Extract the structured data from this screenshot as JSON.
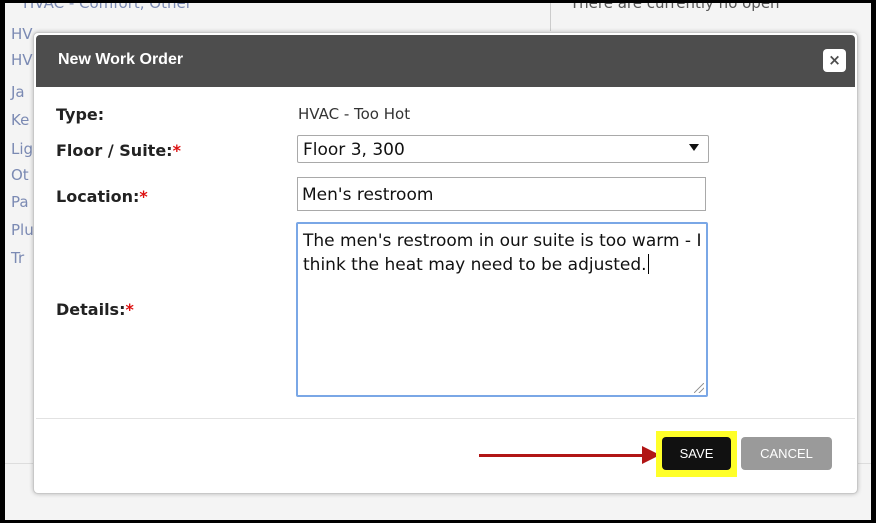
{
  "background": {
    "top_left_text": "HVAC - Comfort, Other",
    "top_right_text": "There are currently no open",
    "left_list": [
      "HV",
      "HV",
      "Ja",
      "Ke",
      "Lig",
      "Ot",
      "Pa",
      "Plu",
      "Tr"
    ]
  },
  "modal": {
    "title": "New Work Order",
    "close_icon": "×",
    "fields": {
      "type_label": "Type:",
      "type_value": "HVAC - Too Hot",
      "floor_label": "Floor / Suite:",
      "floor_value": "Floor 3, 300",
      "location_label": "Location:",
      "location_value": "Men's restroom",
      "details_label": "Details:",
      "details_value": "The men's restroom in our suite is too warm - I think the heat may need to be adjusted."
    },
    "required_marker": "*",
    "buttons": {
      "save": "SAVE",
      "cancel": "CANCEL"
    }
  },
  "colors": {
    "header_bg": "#4d4d4d",
    "required": "#dd1111",
    "highlight": "#ffff29",
    "arrow": "#b11515"
  }
}
